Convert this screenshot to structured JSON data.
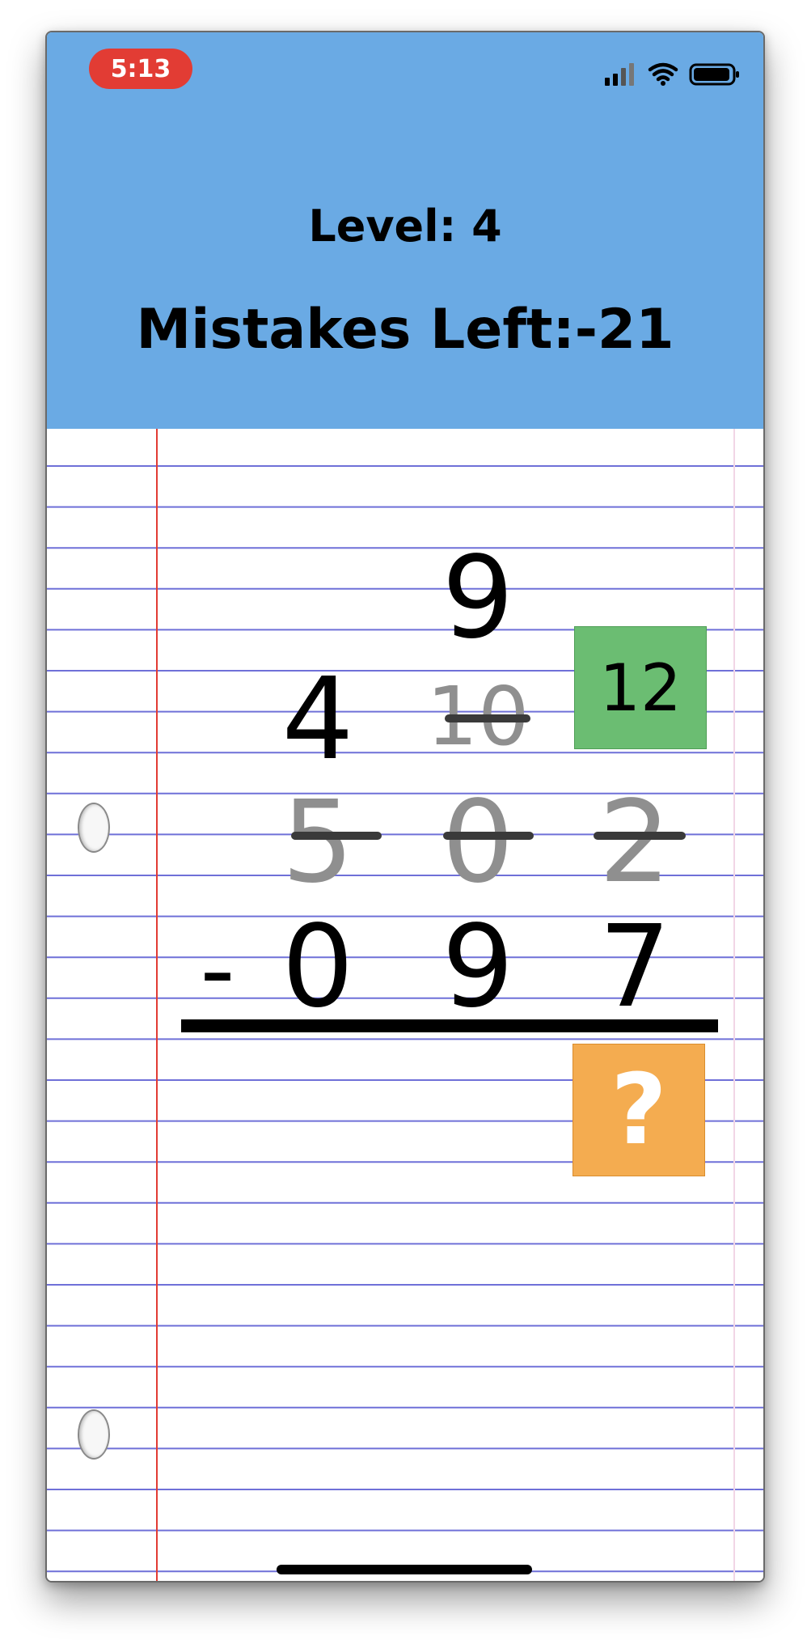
{
  "status_bar": {
    "time": "5:13",
    "icons": [
      "signal-icon",
      "wifi-icon",
      "battery-icon"
    ]
  },
  "header": {
    "level": "Level: 4",
    "mistakes": "Mistakes Left:-21"
  },
  "problem": {
    "borrow_top": "9",
    "borrow_row": [
      "4",
      "10",
      "12"
    ],
    "top_row": [
      "5",
      "0",
      "2"
    ],
    "operator": "-",
    "bottom_row": [
      "0",
      "9",
      "7"
    ],
    "answer_placeholder": "?"
  },
  "colors": {
    "header": "#6AAAE4",
    "time_pill": "#E23C34",
    "active_cell": "#6BBD72",
    "answer_cell": "#F4AC50",
    "ruled_line": "#6F70D8",
    "margin_line": "#E23C34"
  }
}
